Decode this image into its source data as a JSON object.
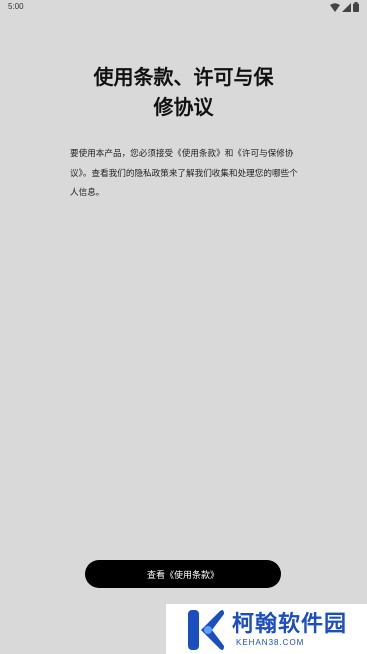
{
  "status_bar": {
    "time": "5:00",
    "icons": [
      "wifi-icon",
      "signal-icon",
      "battery-icon"
    ]
  },
  "page": {
    "title_line1": "使用条款、许可与保",
    "title_line2": "修协议",
    "description": "要使用本产品，您必须接受《使用条款》和《许可与保修协议》。查看我们的隐私政策来了解我们收集和处理您的哪些个人信息。"
  },
  "actions": {
    "view_terms_label": "查看《使用条款》"
  },
  "watermark": {
    "brand": "柯翰软件园",
    "domain": "KEHAN38.COM",
    "color": "#1b4fbf"
  }
}
